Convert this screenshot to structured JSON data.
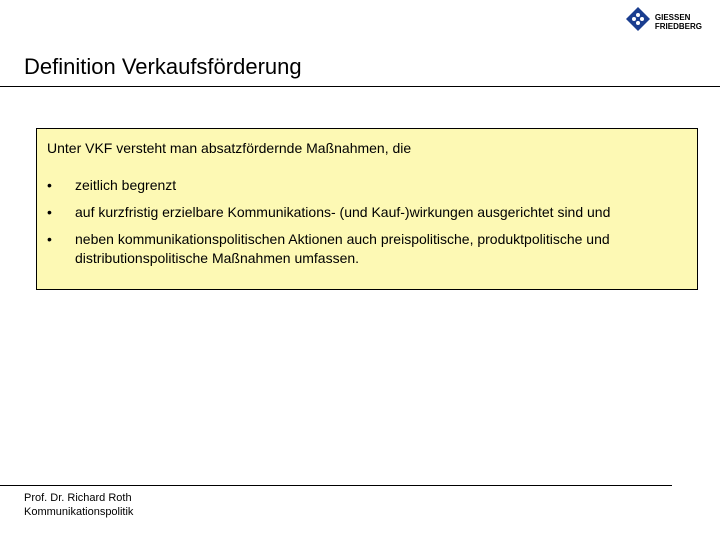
{
  "logo": {
    "line1": "GIESSEN",
    "line2": "FRIEDBERG"
  },
  "header": {
    "title": "Definition Verkaufsförderung"
  },
  "content": {
    "intro": "Unter VKF versteht man absatzfördernde Maßnahmen, die",
    "bullets": [
      "zeitlich begrenzt",
      "auf kurzfristig erzielbare Kommunikations- (und Kauf-)wirkungen ausgerichtet sind und",
      "neben kommunikationspolitischen Aktionen auch preispolitische, produktpolitische und distributionspolitische Maßnahmen umfassen."
    ]
  },
  "footer": {
    "author": "Prof. Dr. Richard Roth",
    "subject": "Kommunikationspolitik"
  }
}
